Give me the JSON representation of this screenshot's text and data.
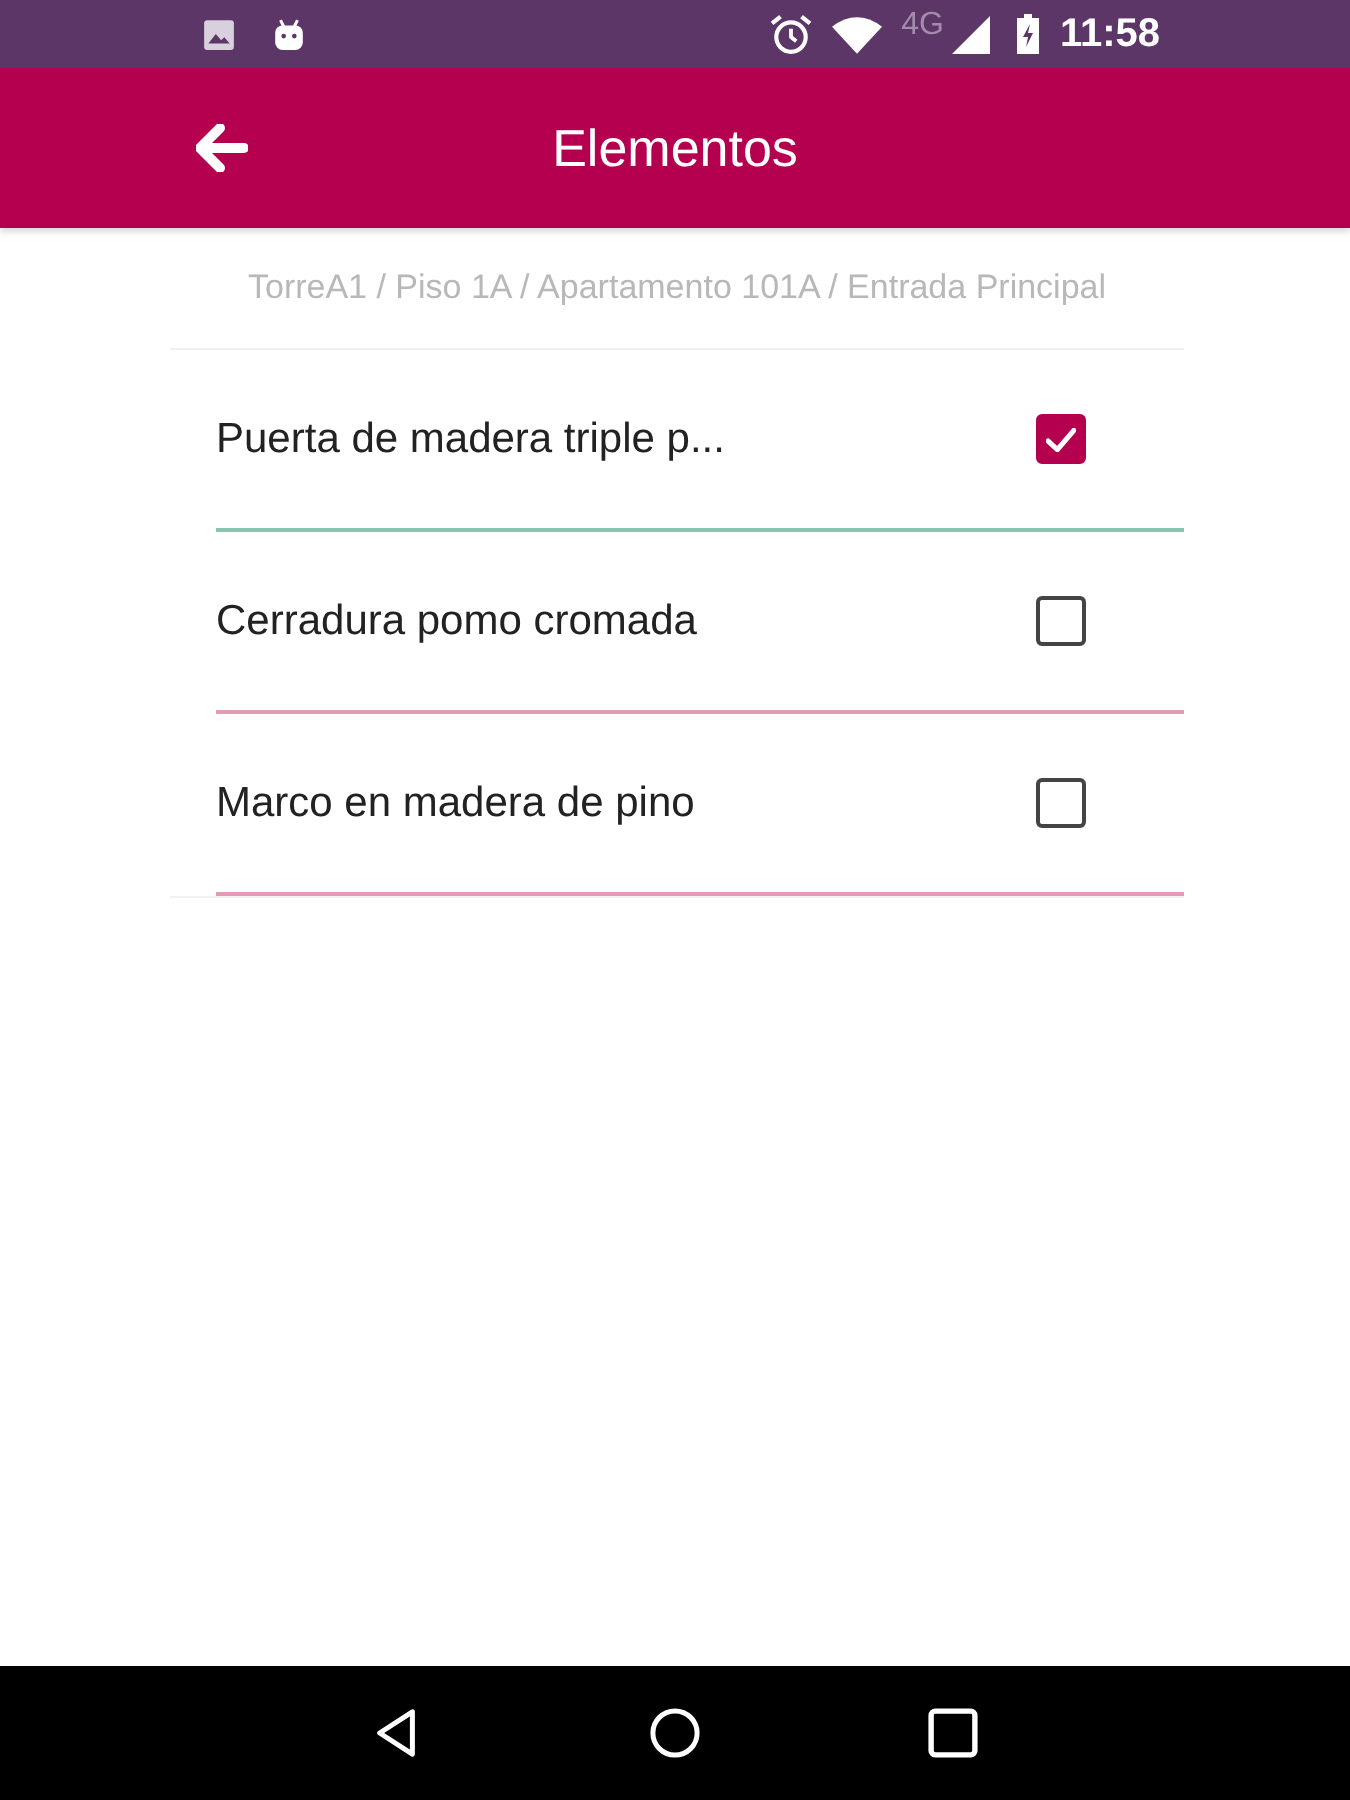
{
  "status_bar": {
    "network": "4G",
    "time": "11:58"
  },
  "app_bar": {
    "title": "Elementos"
  },
  "breadcrumb": "TorreA1 / Piso 1A / Apartamento 101A / Entrada Principal",
  "items": [
    {
      "label": "Puerta de madera triple p...",
      "checked": true
    },
    {
      "label": "Cerradura pomo cromada",
      "checked": false
    },
    {
      "label": "Marco en madera de pino",
      "checked": false
    }
  ]
}
